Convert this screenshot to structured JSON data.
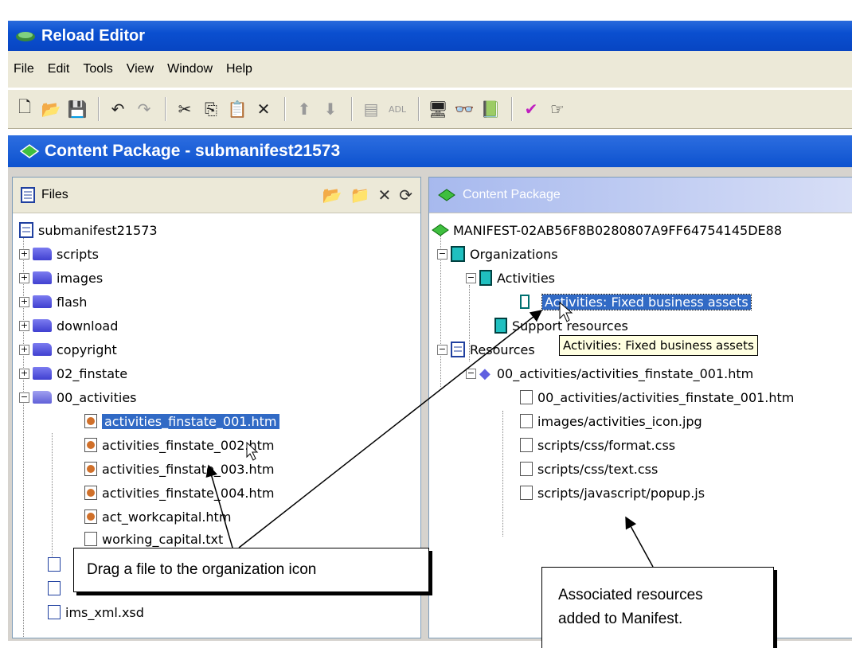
{
  "window": {
    "title": "Reload Editor"
  },
  "menu": [
    "File",
    "Edit",
    "Tools",
    "View",
    "Window",
    "Help"
  ],
  "package_title": "Content Package - submanifest21573",
  "files_pane": {
    "header": "Files",
    "root": "submanifest21573",
    "folders": [
      "scripts",
      "images",
      "flash",
      "download",
      "copyright",
      "02_finstate",
      "00_activities"
    ],
    "activities_files": [
      "activities_finstate_001.htm",
      "activities_finstate_002.htm",
      "activities_finstate_003.htm",
      "activities_finstate_004.htm",
      "act_workcapital.htm",
      "working_capital.txt"
    ],
    "bottom_file": "ims_xml.xsd",
    "selected": "activities_finstate_001.htm"
  },
  "content_pane": {
    "header": "Content Package",
    "manifest": "MANIFEST-02AB56F8B0280807A9FF64754145DE88",
    "organizations": "Organizations",
    "activities": "Activities",
    "item": "Activities: Fixed business assets",
    "support": "Support resources",
    "resources": "Resources",
    "resource_root": "00_activities/activities_finstate_001.htm",
    "resource_files": [
      "00_activities/activities_finstate_001.htm",
      "images/activities_icon.jpg",
      "scripts/css/format.css",
      "scripts/css/text.css",
      "scripts/javascript/popup.js"
    ]
  },
  "tooltip": "Activities: Fixed business assets",
  "callouts": {
    "drag": "Drag a file to the organization icon",
    "associated": "Associated resources\nadded to Manifest."
  }
}
